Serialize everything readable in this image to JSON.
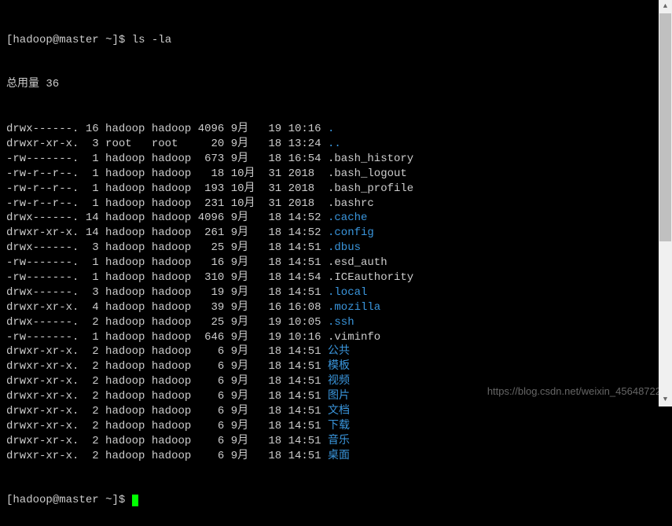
{
  "prompt": {
    "user": "hadoop",
    "host": "master",
    "path": "~",
    "command": "ls -la"
  },
  "total_line": "总用量 36",
  "rows": [
    {
      "perms": "drwx------.",
      "links": "16",
      "owner": "hadoop",
      "group": "hadoop",
      "size": "4096",
      "month": "9月",
      "day": "19",
      "time": "10:16",
      "name": ".",
      "dir": true
    },
    {
      "perms": "drwxr-xr-x.",
      "links": "3",
      "owner": "root",
      "group": "root",
      "size": "20",
      "month": "9月",
      "day": "18",
      "time": "13:24",
      "name": "..",
      "dir": true
    },
    {
      "perms": "-rw-------.",
      "links": "1",
      "owner": "hadoop",
      "group": "hadoop",
      "size": "673",
      "month": "9月",
      "day": "18",
      "time": "16:54",
      "name": ".bash_history",
      "dir": false
    },
    {
      "perms": "-rw-r--r--.",
      "links": "1",
      "owner": "hadoop",
      "group": "hadoop",
      "size": "18",
      "month": "10月",
      "day": "31",
      "time": "2018",
      "name": ".bash_logout",
      "dir": false
    },
    {
      "perms": "-rw-r--r--.",
      "links": "1",
      "owner": "hadoop",
      "group": "hadoop",
      "size": "193",
      "month": "10月",
      "day": "31",
      "time": "2018",
      "name": ".bash_profile",
      "dir": false
    },
    {
      "perms": "-rw-r--r--.",
      "links": "1",
      "owner": "hadoop",
      "group": "hadoop",
      "size": "231",
      "month": "10月",
      "day": "31",
      "time": "2018",
      "name": ".bashrc",
      "dir": false
    },
    {
      "perms": "drwx------.",
      "links": "14",
      "owner": "hadoop",
      "group": "hadoop",
      "size": "4096",
      "month": "9月",
      "day": "18",
      "time": "14:52",
      "name": ".cache",
      "dir": true
    },
    {
      "perms": "drwxr-xr-x.",
      "links": "14",
      "owner": "hadoop",
      "group": "hadoop",
      "size": "261",
      "month": "9月",
      "day": "18",
      "time": "14:52",
      "name": ".config",
      "dir": true
    },
    {
      "perms": "drwx------.",
      "links": "3",
      "owner": "hadoop",
      "group": "hadoop",
      "size": "25",
      "month": "9月",
      "day": "18",
      "time": "14:51",
      "name": ".dbus",
      "dir": true
    },
    {
      "perms": "-rw-------.",
      "links": "1",
      "owner": "hadoop",
      "group": "hadoop",
      "size": "16",
      "month": "9月",
      "day": "18",
      "time": "14:51",
      "name": ".esd_auth",
      "dir": false
    },
    {
      "perms": "-rw-------.",
      "links": "1",
      "owner": "hadoop",
      "group": "hadoop",
      "size": "310",
      "month": "9月",
      "day": "18",
      "time": "14:54",
      "name": ".ICEauthority",
      "dir": false
    },
    {
      "perms": "drwx------.",
      "links": "3",
      "owner": "hadoop",
      "group": "hadoop",
      "size": "19",
      "month": "9月",
      "day": "18",
      "time": "14:51",
      "name": ".local",
      "dir": true
    },
    {
      "perms": "drwxr-xr-x.",
      "links": "4",
      "owner": "hadoop",
      "group": "hadoop",
      "size": "39",
      "month": "9月",
      "day": "16",
      "time": "16:08",
      "name": ".mozilla",
      "dir": true
    },
    {
      "perms": "drwx------.",
      "links": "2",
      "owner": "hadoop",
      "group": "hadoop",
      "size": "25",
      "month": "9月",
      "day": "19",
      "time": "10:05",
      "name": ".ssh",
      "dir": true
    },
    {
      "perms": "-rw-------.",
      "links": "1",
      "owner": "hadoop",
      "group": "hadoop",
      "size": "646",
      "month": "9月",
      "day": "19",
      "time": "10:16",
      "name": ".viminfo",
      "dir": false
    },
    {
      "perms": "drwxr-xr-x.",
      "links": "2",
      "owner": "hadoop",
      "group": "hadoop",
      "size": "6",
      "month": "9月",
      "day": "18",
      "time": "14:51",
      "name": "公共",
      "dir": true
    },
    {
      "perms": "drwxr-xr-x.",
      "links": "2",
      "owner": "hadoop",
      "group": "hadoop",
      "size": "6",
      "month": "9月",
      "day": "18",
      "time": "14:51",
      "name": "模板",
      "dir": true
    },
    {
      "perms": "drwxr-xr-x.",
      "links": "2",
      "owner": "hadoop",
      "group": "hadoop",
      "size": "6",
      "month": "9月",
      "day": "18",
      "time": "14:51",
      "name": "视频",
      "dir": true
    },
    {
      "perms": "drwxr-xr-x.",
      "links": "2",
      "owner": "hadoop",
      "group": "hadoop",
      "size": "6",
      "month": "9月",
      "day": "18",
      "time": "14:51",
      "name": "图片",
      "dir": true
    },
    {
      "perms": "drwxr-xr-x.",
      "links": "2",
      "owner": "hadoop",
      "group": "hadoop",
      "size": "6",
      "month": "9月",
      "day": "18",
      "time": "14:51",
      "name": "文档",
      "dir": true
    },
    {
      "perms": "drwxr-xr-x.",
      "links": "2",
      "owner": "hadoop",
      "group": "hadoop",
      "size": "6",
      "month": "9月",
      "day": "18",
      "time": "14:51",
      "name": "下载",
      "dir": true
    },
    {
      "perms": "drwxr-xr-x.",
      "links": "2",
      "owner": "hadoop",
      "group": "hadoop",
      "size": "6",
      "month": "9月",
      "day": "18",
      "time": "14:51",
      "name": "音乐",
      "dir": true
    },
    {
      "perms": "drwxr-xr-x.",
      "links": "2",
      "owner": "hadoop",
      "group": "hadoop",
      "size": "6",
      "month": "9月",
      "day": "18",
      "time": "14:51",
      "name": "桌面",
      "dir": true
    }
  ],
  "watermark": "https://blog.csdn.net/weixin_45648722"
}
